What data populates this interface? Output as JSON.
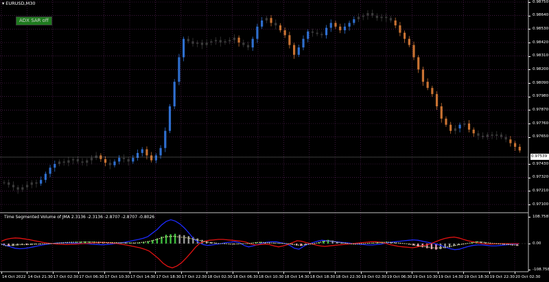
{
  "symbol": "EURUSD,M30",
  "adx_button": "ADX SAR off",
  "indicator_title": "Time Segmented Volume of JMA 2.3136 -2.3136 -2.8707 -2.8707 -0.8026",
  "current_price": "0.97539",
  "price_axis": [
    "0.98750",
    "0.98640",
    "0.98530",
    "0.98420",
    "0.98310",
    "0.98200",
    "0.98090",
    "0.97980",
    "0.97870",
    "0.97760",
    "0.97650",
    "0.97430",
    "0.97320",
    "0.97210",
    "0.97100"
  ],
  "indicator_axis": [
    "108.7587",
    "0.00",
    "-108.7587"
  ],
  "time_axis": [
    "14 Oct 2022",
    "14 Oct 21:30",
    "17 Oct 02:30",
    "17 Oct 06:30",
    "17 Oct 10:30",
    "17 Oct 14:30",
    "17 Oct 18:30",
    "17 Oct 22:30",
    "18 Oct 02:30",
    "18 Oct 06:30",
    "18 Oct 10:30",
    "18 Oct 14:30",
    "18 Oct 18:30",
    "18 Oct 22:30",
    "19 Oct 02:30",
    "19 Oct 06:30",
    "19 Oct 10:30",
    "19 Oct 14:30",
    "19 Oct 18:30",
    "19 Oct 22:30",
    "20 Oct 02:30"
  ],
  "colors": {
    "background": "#000000",
    "grid": "#6b2a6b",
    "bull_candle": "#2f6fcf",
    "bear_candle": "#c87232",
    "neutral_candle": "#3a3a3a",
    "price_line": "#a0a0a0",
    "tsv_up": "#3fbf3f",
    "tsv_down": "#e79ab8",
    "tsv_neutral": "#9a9a9a",
    "line_blue": "#1e2bff",
    "line_red": "#e31212",
    "signal_line": "#e0e0a0"
  },
  "chart_data": {
    "type": "candlestick",
    "price_range": [
      0.971,
      0.9875
    ],
    "indicator_range": [
      -108.7587,
      108.7587
    ],
    "prices": [
      0.9728,
      0.9726,
      0.9724,
      0.9722,
      0.9724,
      0.9726,
      0.9728,
      0.9727,
      0.973,
      0.9735,
      0.974,
      0.9743,
      0.9745,
      0.9744,
      0.9746,
      0.9747,
      0.9745,
      0.9744,
      0.9746,
      0.9748,
      0.975,
      0.9747,
      0.9744,
      0.9742,
      0.9745,
      0.9748,
      0.9747,
      0.9745,
      0.9748,
      0.9752,
      0.9755,
      0.975,
      0.9746,
      0.975,
      0.9756,
      0.977,
      0.979,
      0.981,
      0.983,
      0.9845,
      0.9843,
      0.9841,
      0.9842,
      0.984,
      0.9842,
      0.9843,
      0.9844,
      0.9842,
      0.9843,
      0.9844,
      0.9846,
      0.9842,
      0.984,
      0.9838,
      0.9845,
      0.9855,
      0.986,
      0.9862,
      0.9858,
      0.9856,
      0.9852,
      0.9848,
      0.984,
      0.9832,
      0.9838,
      0.9845,
      0.9851,
      0.985,
      0.9849,
      0.9848,
      0.9854,
      0.9858,
      0.9855,
      0.9852,
      0.9855,
      0.9858,
      0.9861,
      0.9863,
      0.9864,
      0.9866,
      0.9864,
      0.9862,
      0.9863,
      0.9862,
      0.986,
      0.9856,
      0.985,
      0.9845,
      0.984,
      0.983,
      0.982,
      0.981,
      0.9805,
      0.98,
      0.979,
      0.978,
      0.9775,
      0.977,
      0.9772,
      0.9775,
      0.9776,
      0.9771,
      0.9768,
      0.9766,
      0.9765,
      0.9767,
      0.9766,
      0.9767,
      0.9765,
      0.9763,
      0.976,
      0.9757,
      0.9754
    ],
    "tsv": [
      -4,
      -12,
      -10,
      -8,
      -6,
      -6,
      -5,
      -3,
      -3,
      -2,
      -1,
      0,
      2,
      4,
      6,
      7,
      8,
      8,
      9,
      9,
      9,
      8,
      7,
      6,
      6,
      5,
      5,
      4,
      4,
      3,
      4,
      7,
      10,
      15,
      22,
      30,
      38,
      40,
      42,
      38,
      36,
      32,
      28,
      22,
      16,
      10,
      6,
      3,
      0,
      0,
      -2,
      -3,
      -2,
      -1,
      0,
      2,
      5,
      7,
      6,
      4,
      3,
      2,
      1,
      0,
      -4,
      -8,
      -10,
      -6,
      -3,
      0,
      6,
      12,
      16,
      13,
      8,
      4,
      2,
      -2,
      -3,
      -1,
      0,
      2,
      3,
      5,
      7,
      8,
      6,
      4,
      2,
      0,
      -4,
      -8,
      -12,
      -16,
      -20,
      -24,
      -26,
      -24,
      -20,
      -16,
      -10,
      -6,
      -2,
      2,
      6,
      10,
      8,
      5,
      2,
      0,
      -2,
      -4,
      -6,
      -8,
      -10
    ],
    "blue_line": [
      -2,
      -8,
      -14,
      -20,
      -22,
      -21,
      -18,
      -14,
      -10,
      -6,
      -3,
      0,
      2,
      3,
      3,
      3,
      2,
      1,
      0,
      -1,
      -3,
      -4,
      -5,
      -4,
      -2,
      0,
      3,
      6,
      10,
      14,
      18,
      23,
      30,
      45,
      60,
      80,
      95,
      102,
      96,
      84,
      66,
      44,
      20,
      6,
      -4,
      -8,
      -6,
      -3,
      0,
      4,
      6,
      8,
      4,
      -8,
      -14,
      -10,
      -4,
      2,
      6,
      8,
      8,
      4,
      0,
      -8,
      -20,
      -24,
      -12,
      -2,
      4,
      10,
      14,
      12,
      10,
      8,
      6,
      4,
      2,
      0,
      -2,
      -4,
      -6,
      -6,
      -4,
      -2,
      2,
      6,
      8,
      10,
      12,
      14,
      16,
      14,
      10,
      6,
      2,
      -2,
      -8,
      -16,
      -22,
      -26,
      -24,
      -18,
      -12,
      -8,
      -6,
      -6,
      -8,
      -10,
      -10,
      -8,
      -6,
      -4,
      -2,
      -1
    ],
    "red_line": [
      10,
      18,
      22,
      24,
      23,
      20,
      17,
      13,
      9,
      5,
      2,
      0,
      -2,
      -3,
      -4,
      -3,
      -2,
      -1,
      0,
      1,
      3,
      4,
      5,
      4,
      2,
      0,
      -3,
      -6,
      -10,
      -14,
      -18,
      -24,
      -32,
      -48,
      -64,
      -84,
      -98,
      -104,
      -96,
      -82,
      -62,
      -40,
      -16,
      2,
      10,
      14,
      16,
      18,
      18,
      16,
      14,
      12,
      10,
      6,
      -2,
      -6,
      -4,
      -2,
      -4,
      -10,
      -14,
      -10,
      -4,
      4,
      12,
      10,
      4,
      0,
      -6,
      -10,
      -12,
      -10,
      -8,
      -6,
      -4,
      -2,
      0,
      2,
      4,
      6,
      8,
      8,
      6,
      2,
      -4,
      -8,
      -12,
      -14,
      -16,
      -18,
      -14,
      -10,
      -6,
      0,
      8,
      16,
      22,
      26,
      28,
      24,
      18,
      12,
      8,
      4,
      0,
      -2,
      -2,
      -1,
      0,
      0,
      0,
      0,
      0
    ]
  }
}
